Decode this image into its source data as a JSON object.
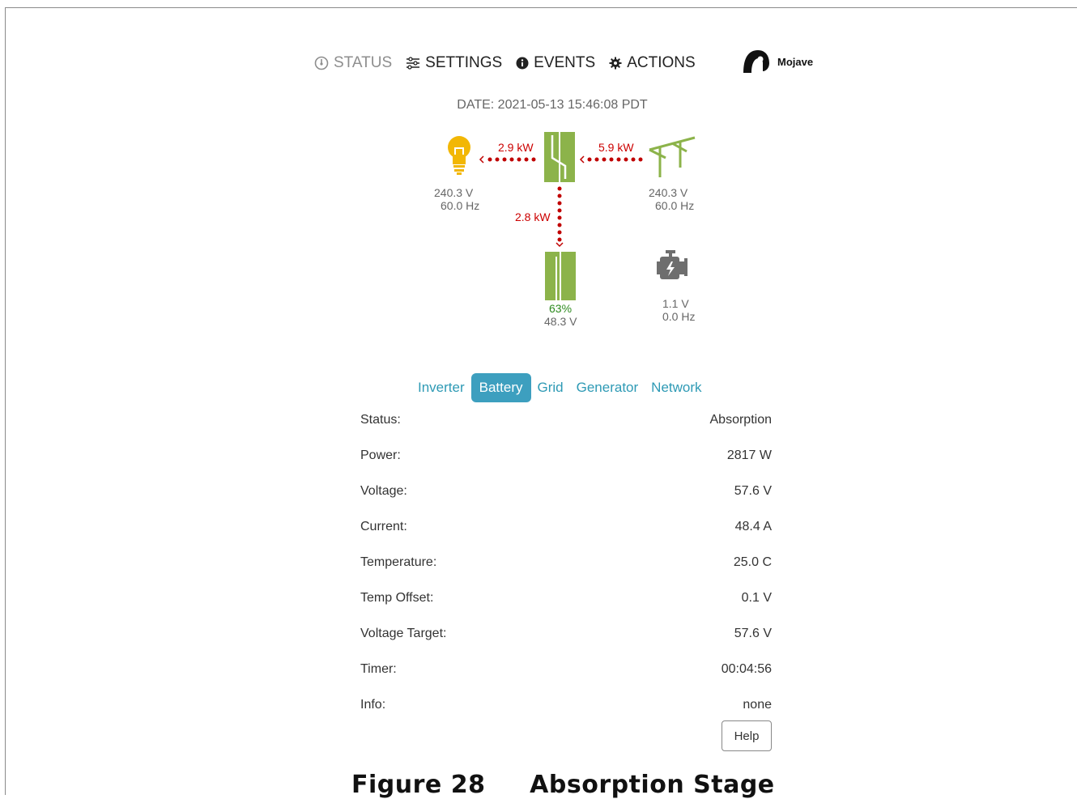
{
  "nav": {
    "status": "STATUS",
    "settings": "SETTINGS",
    "events": "EVENTS",
    "actions": "ACTIONS",
    "brand": "Mojave",
    "icons": [
      "gauge-icon",
      "sliders-icon",
      "info-icon",
      "gear-icon"
    ]
  },
  "date": "DATE: 2021-05-13 15:46:08 PDT",
  "diagram": {
    "load": {
      "power": "2.9 kW",
      "voltage": "240.3 V",
      "freq": "60.0 Hz"
    },
    "grid": {
      "power": "5.9 kW",
      "voltage": "240.3 V",
      "freq": "60.0 Hz"
    },
    "battery": {
      "power": "2.8 kW",
      "soc": "63%",
      "voltage": "48.3 V"
    },
    "generator": {
      "voltage": "1.1 V",
      "freq": "0.0 Hz"
    }
  },
  "tabs": [
    "Inverter",
    "Battery",
    "Grid",
    "Generator",
    "Network"
  ],
  "active_tab": "Battery",
  "rows": [
    {
      "label": "Status:",
      "value": "Absorption"
    },
    {
      "label": "Power:",
      "value": "2817 W"
    },
    {
      "label": "Voltage:",
      "value": "57.6 V"
    },
    {
      "label": "Current:",
      "value": "48.4 A"
    },
    {
      "label": "Temperature:",
      "value": "25.0 C"
    },
    {
      "label": "Temp Offset:",
      "value": "0.1 V"
    },
    {
      "label": "Voltage Target:",
      "value": "57.6 V"
    },
    {
      "label": "Timer:",
      "value": "00:04:56"
    },
    {
      "label": "Info:",
      "value": "none"
    }
  ],
  "help_label": "Help",
  "caption": "Figure 28     Absorption Stage",
  "colors": {
    "accent": "#3d9fbf",
    "flow": "#c00000",
    "device": "#8cb34a",
    "bulb": "#f2b705",
    "soc": "#2e8b1f"
  }
}
